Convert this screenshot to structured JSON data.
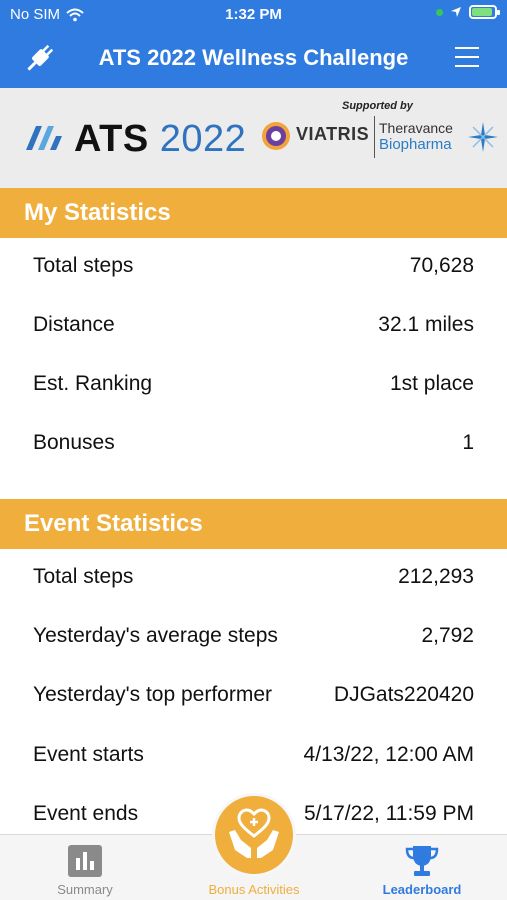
{
  "status_bar": {
    "carrier": "No SIM",
    "time": "1:32 PM"
  },
  "nav": {
    "title": "ATS 2022 Wellness Challenge"
  },
  "logos": {
    "ats_main": "ATS",
    "ats_year": "2022",
    "supported_by": "Supported by",
    "viatris": "VIATRIS",
    "theravance_line1": "Theravance",
    "theravance_line2": "Biopharma"
  },
  "my_statistics": {
    "title": "My Statistics",
    "rows": [
      {
        "label": "Total steps",
        "value": "70,628"
      },
      {
        "label": "Distance",
        "value": "32.1 miles"
      },
      {
        "label": "Est. Ranking",
        "value": "1st place"
      },
      {
        "label": "Bonuses",
        "value": "1"
      }
    ]
  },
  "event_statistics": {
    "title": "Event Statistics",
    "rows": [
      {
        "label": "Total steps",
        "value": "212,293"
      },
      {
        "label": "Yesterday's average steps",
        "value": "2,792"
      },
      {
        "label": "Yesterday's top performer",
        "value": "DJGats220420"
      },
      {
        "label": "Event starts",
        "value": "4/13/22, 12:00 AM"
      },
      {
        "label": "Event ends",
        "value": "5/17/22, 11:59 PM"
      }
    ]
  },
  "tabs": {
    "summary": "Summary",
    "bonus": "Bonus Activities",
    "leaderboard": "Leaderboard"
  },
  "colors": {
    "nav_blue": "#2f7be0",
    "section_orange": "#f0ae3c",
    "logo_band": "#ececec"
  },
  "icons": {
    "plug": "plug-icon",
    "menu": "hamburger-menu-icon",
    "summary": "bar-chart-icon",
    "bonus": "heart-hands-icon",
    "leaderboard": "trophy-icon"
  }
}
